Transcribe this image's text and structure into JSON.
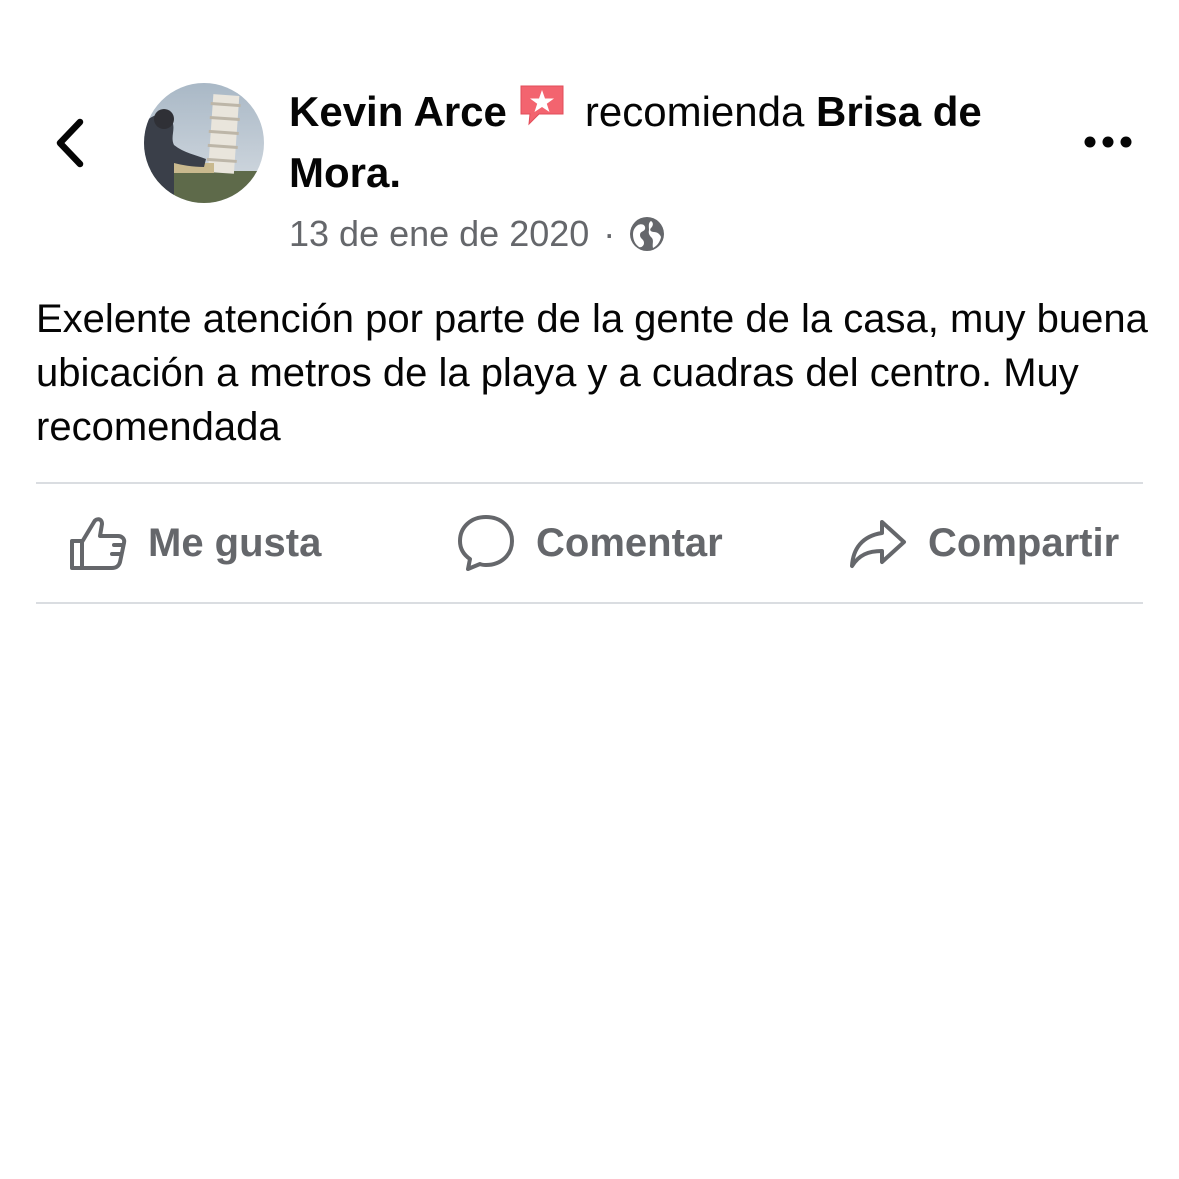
{
  "header": {
    "back_icon": "chevron-left-icon",
    "author_name": "Kevin Arce",
    "recommend_icon": "recommend-star-badge-icon",
    "verb": "recomienda",
    "page_name": "Brisa de Mora.",
    "timestamp": "13 de ene de 2020",
    "separator": "·",
    "privacy_icon": "globe-icon",
    "more_icon": "more-dots-icon"
  },
  "post": {
    "body": "Exelente atención por parte de la gente de la casa, muy buena ubicación a metros de la playa y a cuadras del centro. Muy recomendada"
  },
  "actions": {
    "like_label": "Me gusta",
    "comment_label": "Comentar",
    "share_label": "Compartir"
  },
  "colors": {
    "text_primary": "#050505",
    "text_secondary": "#65676b",
    "divider": "#dadde1",
    "recommend_badge": "#f3646f"
  }
}
